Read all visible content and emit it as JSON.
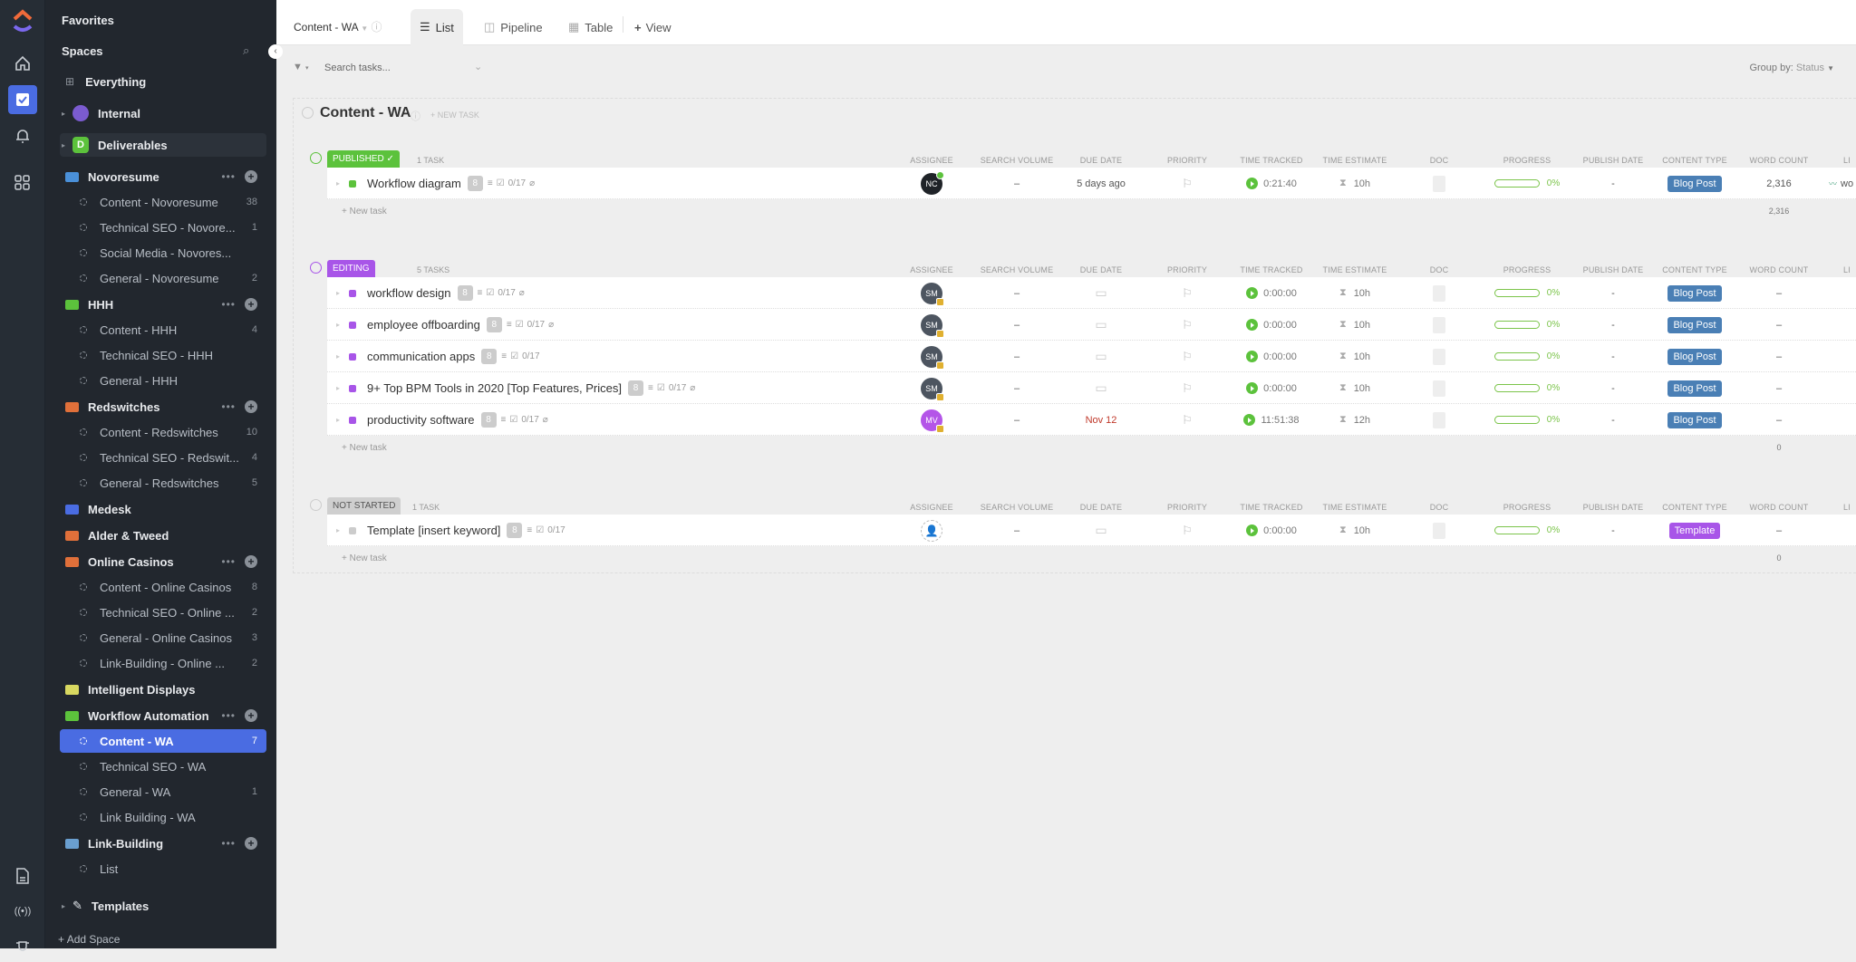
{
  "rail": {
    "icons": [
      "clickup-logo",
      "home-icon",
      "tasks-icon",
      "bell-icon",
      "apps-icon",
      "doc-icon",
      "broadcast-icon",
      "trophy-icon"
    ]
  },
  "sidebar": {
    "favorites": "Favorites",
    "spaces": "Spaces",
    "everything": "Everything",
    "internal": "Internal",
    "deliverables": "Deliverables",
    "deliverables_initial": "D",
    "add_space": "Add Space",
    "templates": "Templates",
    "folders": [
      {
        "name": "Novoresume",
        "color": "#4a90d9",
        "lists": [
          {
            "name": "Content - Novoresume",
            "count": "38"
          },
          {
            "name": "Technical SEO - Novore...",
            "count": "1"
          },
          {
            "name": "Social Media - Novores...",
            "count": ""
          },
          {
            "name": "General - Novoresume",
            "count": "2"
          }
        ]
      },
      {
        "name": "HHH",
        "color": "#5cc23c",
        "lists": [
          {
            "name": "Content - HHH",
            "count": "4"
          },
          {
            "name": "Technical SEO - HHH",
            "count": ""
          },
          {
            "name": "General - HHH",
            "count": ""
          }
        ]
      },
      {
        "name": "Redswitches",
        "color": "#e0703a",
        "lists": [
          {
            "name": "Content - Redswitches",
            "count": "10"
          },
          {
            "name": "Technical SEO - Redswit...",
            "count": "4"
          },
          {
            "name": "General - Redswitches",
            "count": "5"
          }
        ]
      },
      {
        "name": "Medesk",
        "color": "#4a6ce2",
        "lists": []
      },
      {
        "name": "Alder & Tweed",
        "color": "#e0703a",
        "lists": []
      },
      {
        "name": "Online Casinos",
        "color": "#e0703a",
        "lists": [
          {
            "name": "Content - Online Casinos",
            "count": "8"
          },
          {
            "name": "Technical SEO - Online ...",
            "count": "2"
          },
          {
            "name": "General - Online Casinos",
            "count": "3"
          },
          {
            "name": "Link-Building - Online ...",
            "count": "2"
          }
        ]
      },
      {
        "name": "Intelligent Displays",
        "color": "#d8d860",
        "lists": []
      },
      {
        "name": "Workflow Automation",
        "color": "#5cc23c",
        "lists": [
          {
            "name": "Content - WA",
            "count": "7"
          },
          {
            "name": "Technical SEO - WA",
            "count": ""
          },
          {
            "name": "General - WA",
            "count": "1"
          },
          {
            "name": "Link Building - WA",
            "count": ""
          }
        ]
      },
      {
        "name": "Link-Building",
        "color": "#6a9fd0",
        "lists": [
          {
            "name": "List",
            "count": ""
          }
        ]
      }
    ]
  },
  "topbar": {
    "title": "Content - WA",
    "tabs": [
      "List",
      "Pipeline",
      "Table"
    ],
    "add_view": "View"
  },
  "filter": {
    "search_placeholder": "Search tasks...",
    "group_by_label": "Group by:",
    "group_by_value": "Status"
  },
  "list": {
    "title": "Content - WA",
    "new_task": "+ NEW TASK",
    "new_task_row": "+ New task",
    "columns": [
      "ASSIGNEE",
      "SEARCH VOLUME",
      "DUE DATE",
      "PRIORITY",
      "TIME TRACKED",
      "TIME ESTIMATE",
      "DOC",
      "PROGRESS",
      "PUBLISH DATE",
      "CONTENT TYPE",
      "WORD COUNT",
      "LI"
    ],
    "groups": [
      {
        "status": "PUBLISHED",
        "color": "#5cc23c",
        "count": "1 TASK",
        "sum": "2,316",
        "tasks": [
          {
            "name": "Workflow diagram",
            "attach": true,
            "checklist": "0/17",
            "assignee": "NC",
            "avcolor": "#1f2328",
            "search": "–",
            "due": "5 days ago",
            "due_color": "#555",
            "tracked": "0:21:40",
            "estimate": "10h",
            "progress": "0%",
            "publish": "-",
            "ctype": "Blog Post",
            "ccolor": "#4a7fb5",
            "words": "2,316",
            "link": "wo"
          }
        ]
      },
      {
        "status": "EDITING",
        "color": "#a855e8",
        "count": "5 TASKS",
        "sum": "0",
        "tasks": [
          {
            "name": "workflow design",
            "attach": true,
            "checklist": "0/17",
            "assignee": "SM",
            "avcolor": "#4d5560",
            "search": "–",
            "due": "",
            "tracked": "0:00:00",
            "estimate": "10h",
            "progress": "0%",
            "publish": "-",
            "ctype": "Blog Post",
            "ccolor": "#4a7fb5",
            "words": "–"
          },
          {
            "name": "employee offboarding",
            "attach": true,
            "checklist": "0/17",
            "assignee": "SM",
            "avcolor": "#4d5560",
            "search": "–",
            "due": "",
            "tracked": "0:00:00",
            "estimate": "10h",
            "progress": "0%",
            "publish": "-",
            "ctype": "Blog Post",
            "ccolor": "#4a7fb5",
            "words": "–"
          },
          {
            "name": "communication apps",
            "attach": false,
            "checklist": "0/17",
            "assignee": "SM",
            "avcolor": "#4d5560",
            "search": "–",
            "due": "",
            "tracked": "0:00:00",
            "estimate": "10h",
            "progress": "0%",
            "publish": "-",
            "ctype": "Blog Post",
            "ccolor": "#4a7fb5",
            "words": "–"
          },
          {
            "name": "9+ Top BPM Tools in 2020 [Top Features, Prices]",
            "attach": true,
            "checklist": "0/17",
            "assignee": "SM",
            "avcolor": "#4d5560",
            "search": "–",
            "due": "",
            "tracked": "0:00:00",
            "estimate": "10h",
            "progress": "0%",
            "publish": "-",
            "ctype": "Blog Post",
            "ccolor": "#4a7fb5",
            "words": "–"
          },
          {
            "name": "productivity software",
            "attach": true,
            "checklist": "0/17",
            "assignee": "MV",
            "avcolor": "#b455e8",
            "search": "–",
            "due": "Nov 12",
            "due_color": "#c0392b",
            "tracked": "11:51:38",
            "estimate": "12h",
            "progress": "0%",
            "publish": "-",
            "ctype": "Blog Post",
            "ccolor": "#4a7fb5",
            "words": "–"
          }
        ]
      },
      {
        "status": "NOT STARTED",
        "color": "#cfcfcf",
        "count": "1 TASK",
        "sum": "0",
        "tasks": [
          {
            "name": "Template [insert keyword]",
            "attach": false,
            "checklist": "0/17",
            "assignee": "",
            "avcolor": "",
            "search": "–",
            "due": "",
            "tracked": "0:00:00",
            "estimate": "10h",
            "progress": "0%",
            "publish": "-",
            "ctype": "Template",
            "ccolor": "#a855e8",
            "words": "–"
          }
        ]
      }
    ]
  }
}
